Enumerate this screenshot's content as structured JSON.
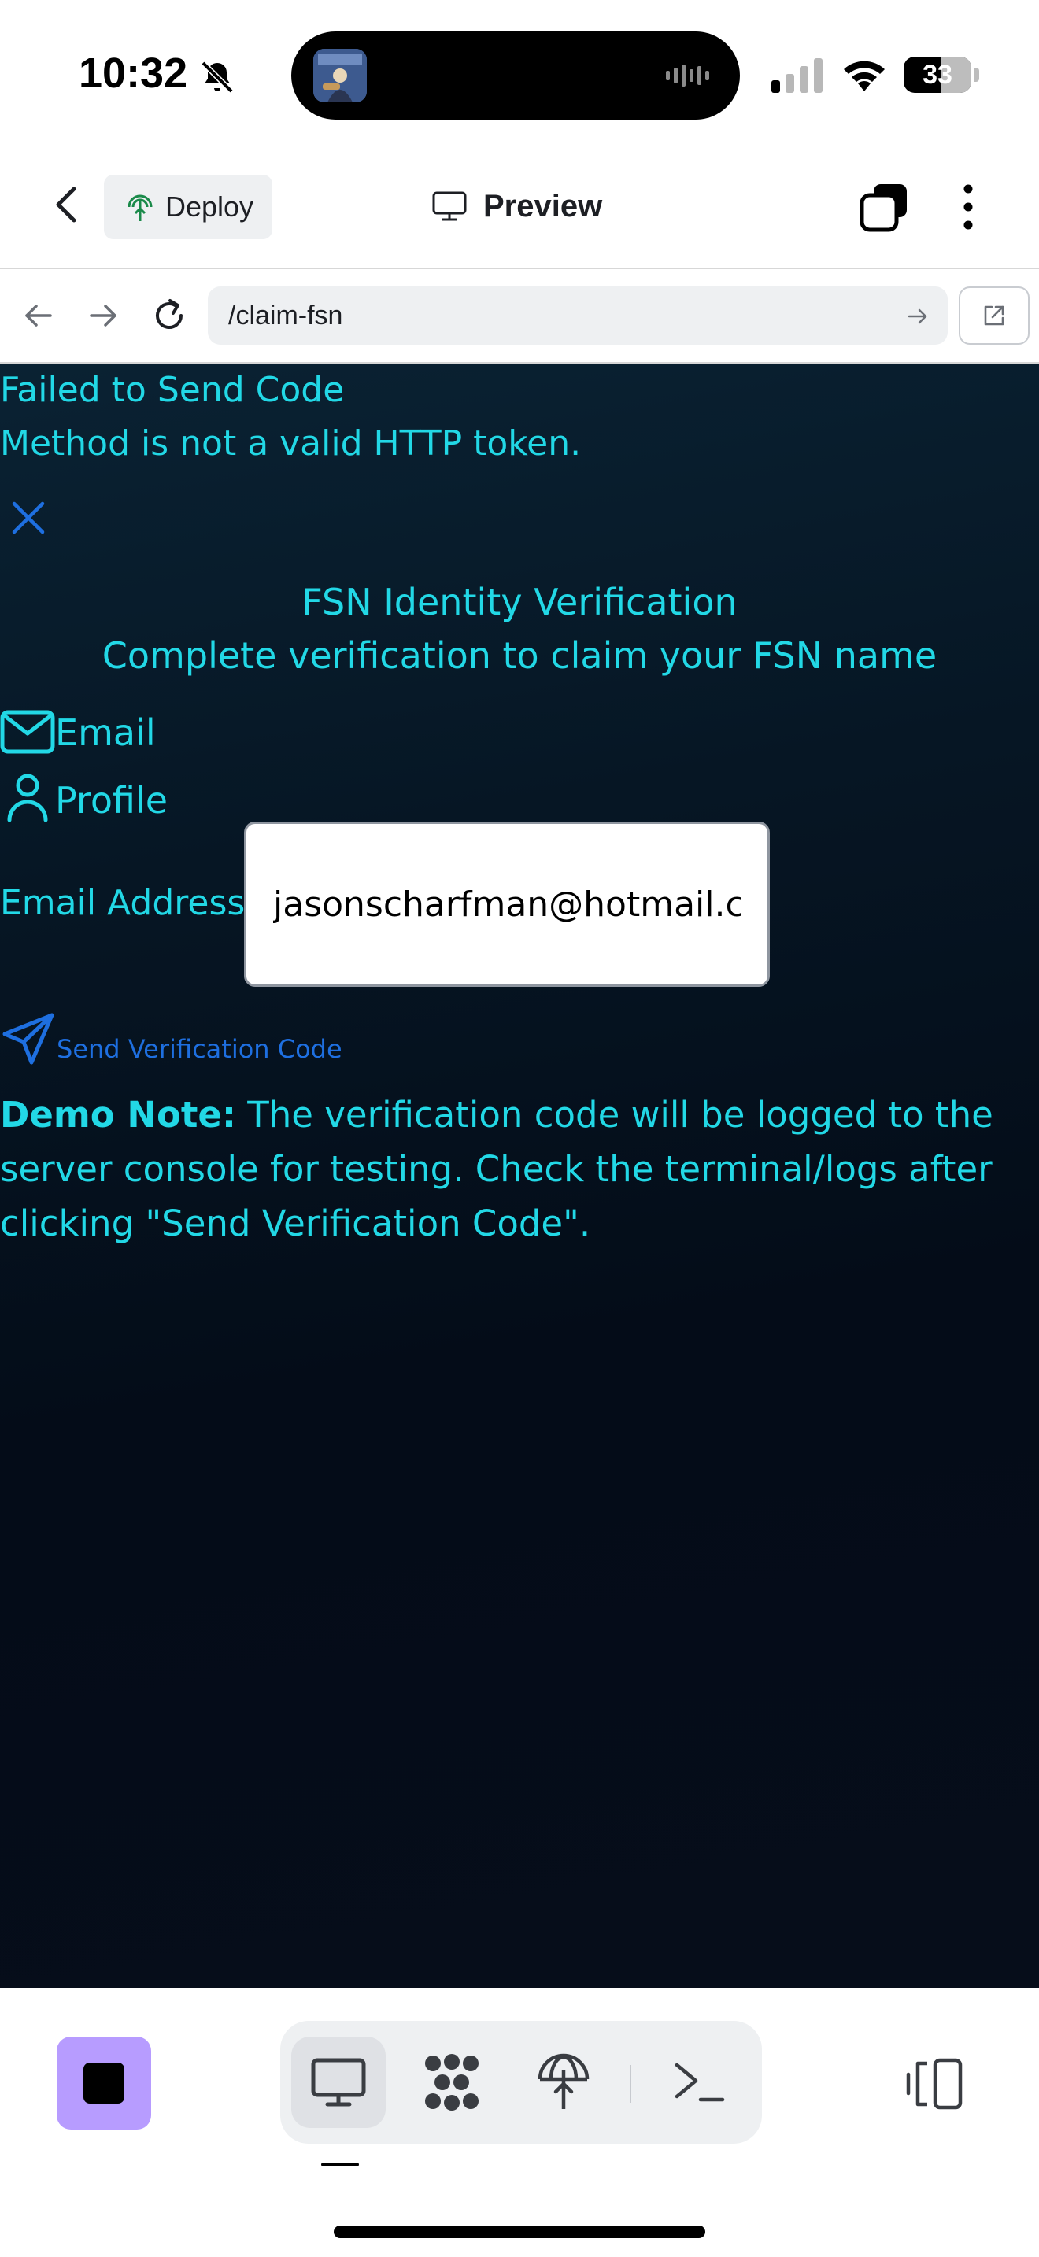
{
  "status_bar": {
    "time": "10:32",
    "battery": "33",
    "icons": [
      "bell-slash-icon",
      "cellular-signal-icon",
      "wifi-icon",
      "battery-icon"
    ]
  },
  "header": {
    "deploy_label": "Deploy",
    "preview_label": "Preview"
  },
  "url_bar": {
    "path": "/claim-fsn"
  },
  "page": {
    "error_title": "Failed to Send Code",
    "error_message": "Method is not a valid HTTP token.",
    "heading": "FSN Identity Verification",
    "subheading": "Complete verification to claim your FSN name",
    "tabs": [
      {
        "label": "Email",
        "icon": "mail-icon"
      },
      {
        "label": "Profile",
        "icon": "user-icon"
      }
    ],
    "email_label": "Email Address",
    "email_value": "jasonscharfman@hotmail.com",
    "send_label": "Send Verification Code",
    "note_bold": "Demo Note:",
    "note_text": " The verification code will be logged to the server console for testing. Check the terminal/logs after clicking \"Send Verification Code\"."
  },
  "colors": {
    "text_accent": "#22d8e6",
    "link_blue": "#1e6fe0",
    "stop_button": "#b79cff",
    "page_background": "#061624"
  }
}
